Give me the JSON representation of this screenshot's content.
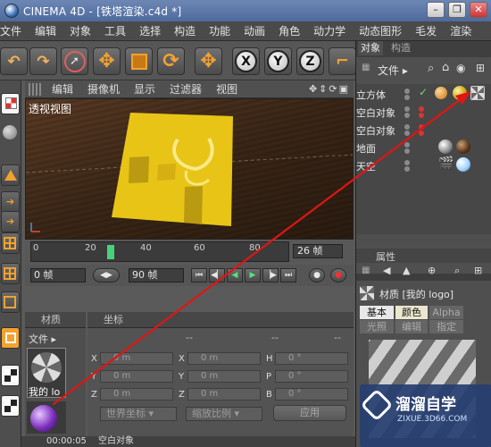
{
  "window": {
    "title": "CINEMA 4D - [铁塔渲染.c4d *]",
    "minimize": "–",
    "restore": "❐",
    "close": "✕"
  },
  "menubar": [
    "文件",
    "编辑",
    "对象",
    "工具",
    "选择",
    "构造",
    "功能",
    "动画",
    "角色",
    "动力学",
    "动态图形",
    "毛发",
    "渲染"
  ],
  "toolbar": {
    "x_label": "X",
    "y_label": "Y",
    "z_label": "Z"
  },
  "viewport": {
    "menus": [
      "编辑",
      "摄像机",
      "显示",
      "过滤器",
      "视图"
    ],
    "label": "透视视图"
  },
  "timeline": {
    "ticks": [
      "0",
      "20",
      "40",
      "60",
      "80"
    ],
    "marker": "26",
    "frame_field": "26 帧"
  },
  "transport": {
    "start": "0 帧",
    "end": "90 帧"
  },
  "material_manager": {
    "title": "材质",
    "menu": "文件",
    "material_name": "我的 lo"
  },
  "coordinates": {
    "title": "坐标",
    "dashes": [
      "--",
      "--",
      "--"
    ],
    "rows": [
      {
        "a1": "X",
        "v1": "0 m",
        "a2": "X",
        "v2": "0 m",
        "a3": "H",
        "v3": "0 °"
      },
      {
        "a1": "Y",
        "v1": "0 m",
        "a2": "Y",
        "v2": "0 m",
        "a3": "P",
        "v3": "0 °"
      },
      {
        "a1": "Z",
        "v1": "0 m",
        "a2": "Z",
        "v2": "0 m",
        "a3": "B",
        "v3": "0 °"
      }
    ],
    "world": "世界坐标",
    "scale": "缩放比例",
    "apply": "应用"
  },
  "object_manager": {
    "tabs": [
      "对象",
      "构造"
    ],
    "menu": "文件",
    "objects": [
      "立方体",
      "空白对象",
      "空白对象",
      "地面",
      "天空"
    ]
  },
  "attributes": {
    "header": "属性",
    "material_title": "材质 [我的 logo]",
    "tabs_row1": [
      "基本",
      "颜色",
      "Alpha"
    ],
    "tabs_row2": [
      "光照",
      "编辑",
      "指定"
    ]
  },
  "watermark": {
    "name": "溜溜自学",
    "url": "ZIXUE.3D66.COM"
  },
  "status": {
    "time": "00:00:05",
    "text": "空白对象"
  },
  "colors": {
    "accent_green": "#47d27a",
    "arrow_red": "#e01515",
    "logo_yellow": "#e8c417"
  }
}
